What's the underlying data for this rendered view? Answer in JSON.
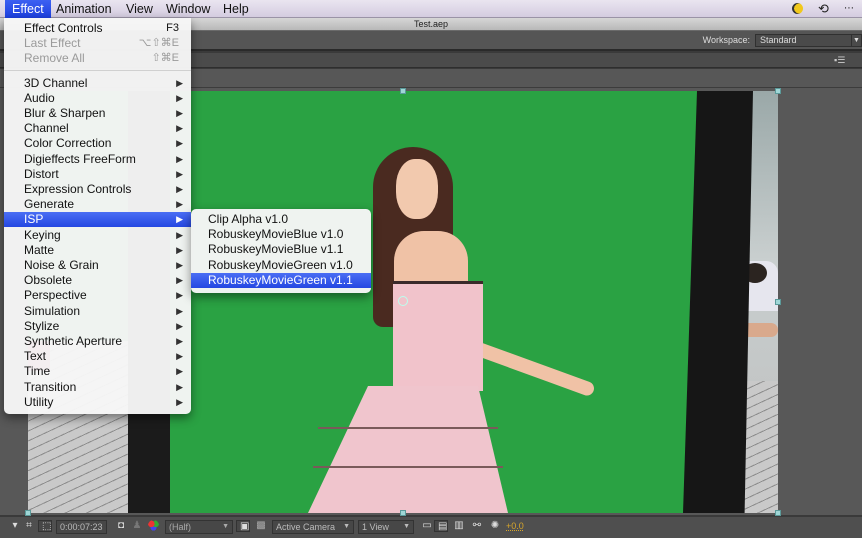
{
  "menubar": {
    "items": [
      {
        "label": "Effect",
        "active": true
      },
      {
        "label": "Animation",
        "active": false
      },
      {
        "label": "View",
        "active": false
      },
      {
        "label": "Window",
        "active": false
      },
      {
        "label": "Help",
        "active": false
      }
    ],
    "status_icons": [
      "moon-icon",
      "time-machine-icon",
      "more-icon"
    ]
  },
  "window": {
    "title": "Test.aep"
  },
  "workspace": {
    "label": "Workspace:",
    "value": "Standard"
  },
  "effect_menu": {
    "top_items": [
      {
        "label": "Effect Controls",
        "shortcut": "F3",
        "enabled": true
      },
      {
        "label": "Last Effect",
        "shortcut": "⌥⇧⌘E",
        "enabled": false
      },
      {
        "label": "Remove All",
        "shortcut": "⇧⌘E",
        "enabled": false
      }
    ],
    "categories": [
      {
        "label": "3D Channel"
      },
      {
        "label": "Audio"
      },
      {
        "label": "Blur & Sharpen"
      },
      {
        "label": "Channel"
      },
      {
        "label": "Color Correction"
      },
      {
        "label": "Digieffects FreeForm"
      },
      {
        "label": "Distort"
      },
      {
        "label": "Expression Controls"
      },
      {
        "label": "Generate"
      },
      {
        "label": "ISP",
        "selected": true
      },
      {
        "label": "Keying"
      },
      {
        "label": "Matte"
      },
      {
        "label": "Noise & Grain"
      },
      {
        "label": "Obsolete"
      },
      {
        "label": "Perspective"
      },
      {
        "label": "Simulation"
      },
      {
        "label": "Stylize"
      },
      {
        "label": "Synthetic Aperture"
      },
      {
        "label": "Text"
      },
      {
        "label": "Time"
      },
      {
        "label": "Transition"
      },
      {
        "label": "Utility"
      }
    ]
  },
  "isp_submenu": {
    "items": [
      {
        "label": "Clip Alpha v1.0"
      },
      {
        "label": "RobuskeyMovieBlue v1.0"
      },
      {
        "label": "RobuskeyMovieBlue v1.1"
      },
      {
        "label": "RobuskeyMovieGreen v1.0"
      },
      {
        "label": "RobuskeyMovieGreen v1.1",
        "selected": true
      }
    ]
  },
  "viewer_toolbar": {
    "timecode": "0:00:07:23",
    "resolution": "(Half)",
    "camera": "Active Camera",
    "views": "1 View",
    "exposure": "+0.0"
  },
  "colors": {
    "menu_highlight": "#2447e2",
    "green_screen": "#2aa243",
    "panel_bg": "#585858",
    "exposure_text": "#d8a62a"
  }
}
